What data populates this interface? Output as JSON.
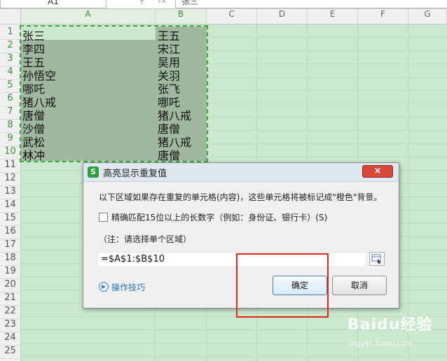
{
  "formula_bar": {
    "name_box": "A1",
    "zoom_icon": "zoom-icon",
    "fx_label": "fx",
    "formula": "张三"
  },
  "columns": [
    "A",
    "B",
    "C",
    "D",
    "E",
    "F",
    "G"
  ],
  "rows": [
    "1",
    "2",
    "3",
    "4",
    "5",
    "6",
    "7",
    "8",
    "9",
    "10",
    "11",
    "12",
    "13",
    "14",
    "15",
    "16",
    "17",
    "18",
    "19",
    "20",
    "21",
    "22",
    "23",
    "24",
    "25"
  ],
  "cells": {
    "A": [
      "张三",
      "李四",
      "王五",
      "孙悟空",
      "哪吒",
      "猪八戒",
      "唐僧",
      "沙僧",
      "武松",
      "林冲"
    ],
    "B": [
      "王五",
      "宋江",
      "吴用",
      "关羽",
      "张飞",
      "哪吒",
      "猪八戒",
      "唐僧",
      "猪八戒",
      "唐僧"
    ]
  },
  "dialog": {
    "title": "高亮显示重复值",
    "app_icon_text": "S",
    "close_text": "×",
    "description": "以下区域如果存在重复的单元格(内容)，这些单元格将被标记成\"橙色\"背景。",
    "checkbox_label": "精确匹配15位以上的长数字（例如：身份证、银行卡）(S)",
    "checkbox_checked": false,
    "note": "（注：请选择单个区域）",
    "range_value": "=$A$1:$B$10",
    "tips_label": "操作技巧",
    "ok_label": "确定",
    "cancel_label": "取消"
  },
  "watermark": {
    "main": "Baidu经验",
    "sub": "jingyan.baidu.com"
  },
  "colors": {
    "sheet_bg": "#cce8cf",
    "selection": "#9fb89f",
    "dashed_border": "#3fa53f",
    "highlight_box": "#e1251b",
    "close": "#d9473a"
  }
}
